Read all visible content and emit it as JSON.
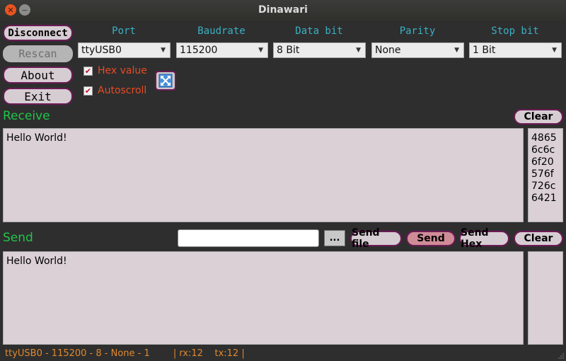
{
  "window": {
    "title": "Dinawari"
  },
  "buttons": {
    "disconnect": "Disconnect",
    "rescan": "Rescan",
    "about": "About",
    "exit": "Exit",
    "clear_receive": "Clear",
    "browse": "...",
    "send_file": "Send file",
    "send": "Send",
    "send_hex": "Send Hex",
    "clear_send": "Clear"
  },
  "settings": {
    "headers": [
      "Port",
      "Baudrate",
      "Data bit",
      "Parity",
      "Stop bit"
    ],
    "port": "ttyUSB0",
    "baudrate": "115200",
    "data_bit": "8 Bit",
    "parity": "None",
    "stop_bit": "1 Bit"
  },
  "options": {
    "hex_value": {
      "label": "Hex value",
      "checked": true
    },
    "autoscroll": {
      "label": "Autoscroll",
      "checked": true
    }
  },
  "receive": {
    "label": "Receive",
    "text": "Hello World!",
    "hex": "48656c6c6f20576f726c6421"
  },
  "send": {
    "label": "Send",
    "input_value": "",
    "text": "Hello World!",
    "hex": ""
  },
  "status": {
    "connection": "ttyUSB0 - 115200 - 8 - None - 1",
    "rx": "| rx:12",
    "tx": "tx:12 |"
  },
  "colors": {
    "accent": "#6c1a55",
    "section_label": "#22c44a",
    "header_label": "#3ab0c4",
    "option_label": "#ea4a24",
    "status_text": "#e0882e"
  },
  "icons": [
    "close-icon",
    "minimize-icon",
    "fullscreen-icon",
    "dropdown-arrow-icon",
    "checkmark-icon",
    "resize-grip-icon"
  ]
}
